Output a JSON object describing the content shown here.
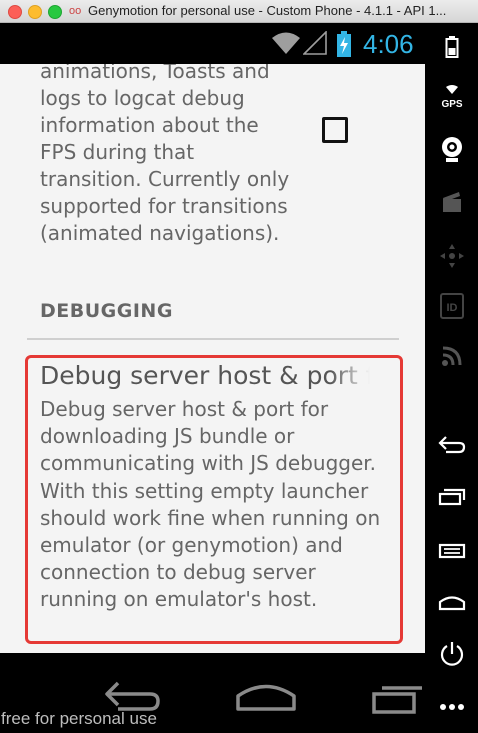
{
  "window": {
    "title": "Genymotion for personal use - Custom Phone - 4.1.1 - API 1..."
  },
  "status_bar": {
    "time": "4:06",
    "icons": [
      "wifi-icon",
      "signal-icon",
      "battery-charging-icon"
    ]
  },
  "content": {
    "previous_summary": "animations, Toasts and logs to logcat debug information about the FPS during that transition. Currently only supported for transitions (animated navigations).",
    "previous_checkbox_checked": false,
    "category_header": "DEBUGGING",
    "debug_pref": {
      "title": "Debug server host & port for device",
      "summary": "Debug server host & port for downloading JS bundle or communicating with JS debugger. With this setting empty launcher should work fine when running on emulator (or genymotion) and connection to debug server running on emulator's host."
    }
  },
  "sidebar": {
    "items": [
      {
        "icon": "battery-icon"
      },
      {
        "icon": "gps-icon",
        "label": "GPS"
      },
      {
        "icon": "webcam-icon"
      },
      {
        "icon": "clapperboard-icon"
      },
      {
        "icon": "dpad-icon"
      },
      {
        "icon": "id-icon",
        "label": "ID"
      },
      {
        "icon": "rss-icon"
      },
      {
        "icon": "back-icon"
      },
      {
        "icon": "recent-apps-icon"
      },
      {
        "icon": "menu-icon"
      },
      {
        "icon": "home-icon"
      },
      {
        "icon": "power-icon"
      },
      {
        "icon": "more-icon"
      }
    ]
  },
  "navbar": {
    "buttons": [
      "back-icon",
      "home-icon",
      "recent-apps-icon"
    ]
  },
  "watermark": "free for personal use",
  "colors": {
    "highlight": "#e53935",
    "clock": "#33b5e5",
    "content_bg": "#f4f4f4"
  }
}
